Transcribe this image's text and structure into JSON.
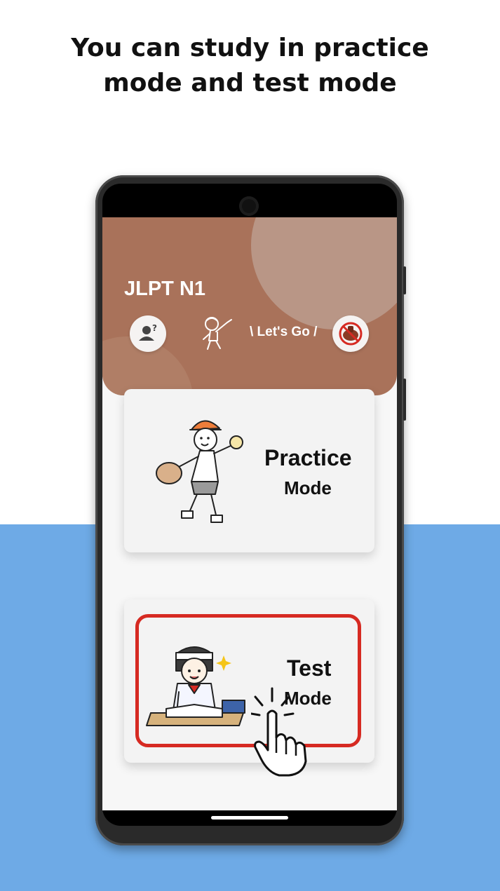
{
  "headline": {
    "line1": "You can study in practice",
    "line2": "mode and test mode"
  },
  "app": {
    "title": "JLPT N1",
    "lets_go": "\\ Let's Go /",
    "profile_button_icon": "user-question-icon",
    "mascot_icon": "pointing-child-icon",
    "no_ads_button_icon": "no-ads-icon"
  },
  "cards": {
    "practice": {
      "label_main": "Practice",
      "label_sub": "Mode",
      "illustration": "baseball-child-illustration"
    },
    "test": {
      "label_main": "Test",
      "label_sub": "Mode",
      "illustration": "studying-child-illustration"
    }
  },
  "overlay": {
    "icon": "tap-hand-icon"
  },
  "colors": {
    "header": "#a9725a",
    "background_blue": "#6eaae6",
    "highlight": "#d62a22"
  }
}
